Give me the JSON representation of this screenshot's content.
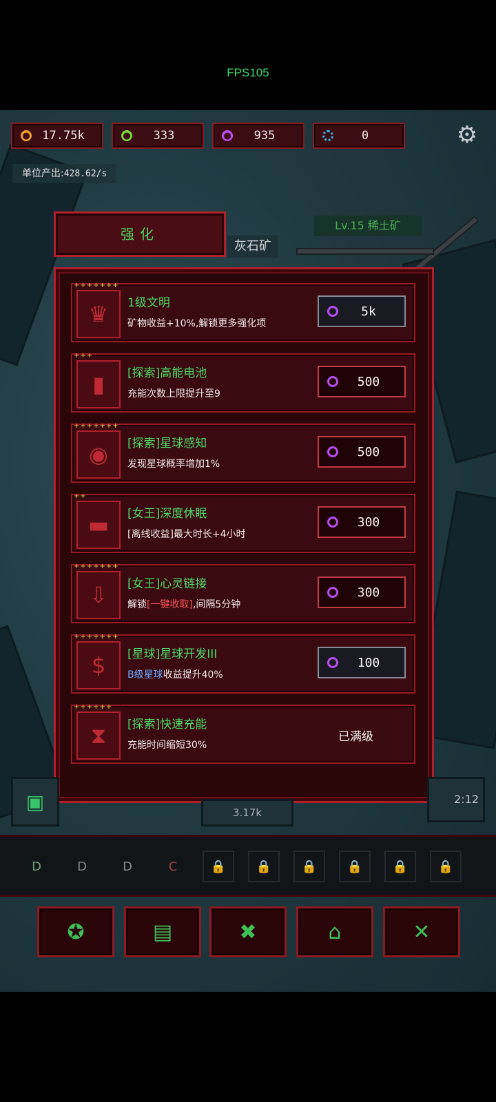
{
  "fps": "FPS105",
  "resources": [
    {
      "icon": "gold-coin-icon",
      "color": "#f0a030",
      "value": "17.75k"
    },
    {
      "icon": "green-gem-icon",
      "color": "#7bd43a",
      "value": "333"
    },
    {
      "icon": "purple-crystal-icon",
      "color": "#b64df0",
      "value": "935"
    },
    {
      "icon": "blue-core-icon",
      "color": "#3ab8e8",
      "value": "0"
    }
  ],
  "unit_output": {
    "label": "单位产出:",
    "value": "428.62/s"
  },
  "tab_label": "强化",
  "mine_label": "灰石矿",
  "level_label": "Lv.15 稀土矿",
  "upgrades": [
    {
      "stars": "+++++++",
      "icon": "crown-icon",
      "glyph": "♛",
      "title": "1级文明",
      "desc": "矿物收益+10%,解锁更多强化项",
      "cost": "5k",
      "maxed": false,
      "dark": true
    },
    {
      "stars": "+++",
      "icon": "battery-icon",
      "glyph": "▮",
      "title": "[探索]高能电池",
      "desc": "充能次数上限提升至9",
      "cost": "500",
      "maxed": false,
      "dark": false
    },
    {
      "stars": "+++++++",
      "icon": "eye-icon",
      "glyph": "◉",
      "title": "[探索]星球感知",
      "desc": "发现星球概率增加1%",
      "cost": "500",
      "maxed": false,
      "dark": false
    },
    {
      "stars": "++",
      "icon": "bed-icon",
      "glyph": "▬",
      "title": "[女王]深度休眠",
      "desc": "[离线收益]最大时长+4小时",
      "cost": "300",
      "maxed": false,
      "dark": false
    },
    {
      "stars": "+++++++",
      "icon": "collect-icon",
      "glyph": "⇩",
      "title": "[女王]心灵链接",
      "desc_pre": "解锁",
      "desc_hl": "[一键收取]",
      "desc_post": ",间隔5分钟",
      "cost": "300",
      "maxed": false,
      "dark": false
    },
    {
      "stars": "+++++++",
      "icon": "dollar-icon",
      "glyph": "$",
      "title": "[星球]星球开发III",
      "desc_hl_blue": "B级星球",
      "desc_post": "收益提升40%",
      "cost": "100",
      "maxed": false,
      "dark": false
    },
    {
      "stars": "++++++",
      "icon": "hourglass-icon",
      "glyph": "⧗",
      "title": "[探索]快速充能",
      "desc": "充能时间缩短30%",
      "maxed_label": "已满级",
      "maxed": true
    }
  ],
  "bottom_middle": "3.17k",
  "bottom_right_time": "2:12",
  "unit_slots": [
    "D",
    "D",
    "D",
    "C"
  ],
  "bottom_nav": [
    {
      "icon": "planet-icon",
      "glyph": "✪"
    },
    {
      "icon": "cash-icon",
      "glyph": "▤"
    },
    {
      "icon": "tools-icon",
      "glyph": "✖"
    },
    {
      "icon": "gift-icon",
      "glyph": "⌂"
    },
    {
      "icon": "swords-icon",
      "glyph": "✕"
    }
  ]
}
